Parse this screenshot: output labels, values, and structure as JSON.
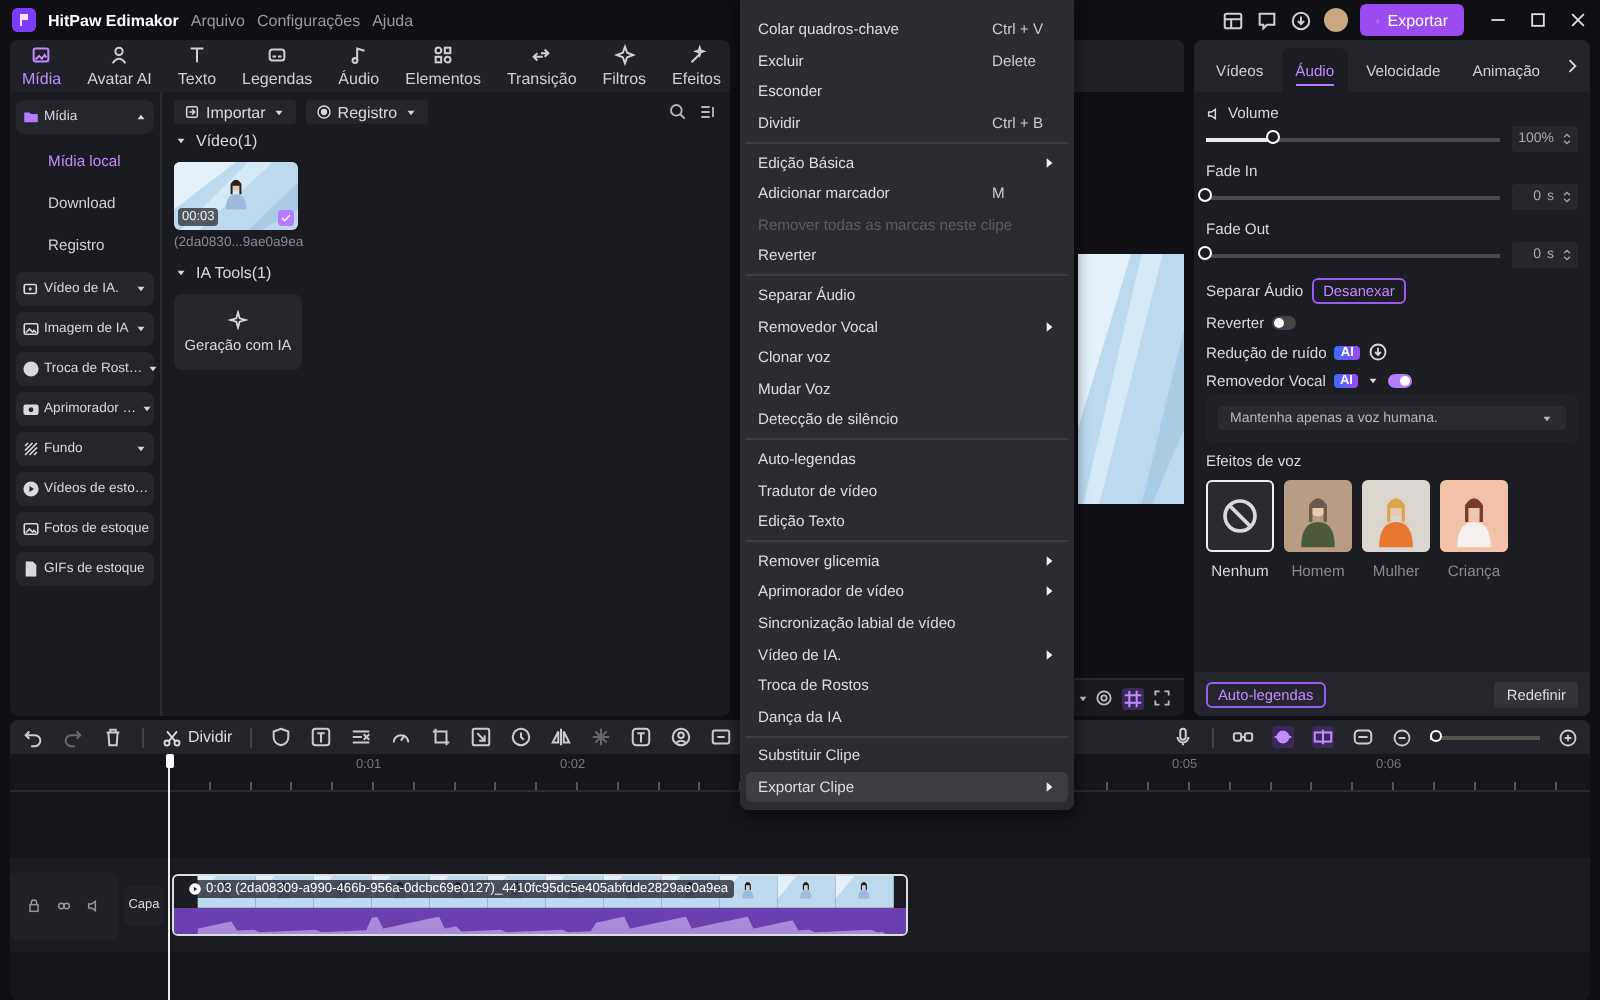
{
  "window": {
    "app_name": "HitPaw Edimakor",
    "menus": [
      "Arquivo",
      "Configurações",
      "Ajuda"
    ],
    "export_button": "Exportar"
  },
  "main_tabs": [
    {
      "label": "Mídia",
      "selected": true
    },
    {
      "label": "Avatar AI",
      "selected": false
    },
    {
      "label": "Texto",
      "selected": false
    },
    {
      "label": "Legendas",
      "selected": false
    },
    {
      "label": "Áudio",
      "selected": false
    },
    {
      "label": "Elementos",
      "selected": false
    },
    {
      "label": "Transição",
      "selected": false
    },
    {
      "label": "Filtros",
      "selected": false
    },
    {
      "label": "Efeitos",
      "selected": false
    }
  ],
  "sidebar": {
    "items": [
      {
        "label": "Mídia",
        "expanded": true,
        "selected": false,
        "children": [
          {
            "label": "Mídia local",
            "selected": true
          },
          {
            "label": "Download",
            "selected": false
          },
          {
            "label": "Registro",
            "selected": false
          }
        ]
      },
      {
        "label": "Vídeo de IA.",
        "expanded": false,
        "selected": false
      },
      {
        "label": "Imagem de IA",
        "expanded": false,
        "selected": false
      },
      {
        "label": "Troca de Rost…",
        "expanded": false,
        "selected": false
      },
      {
        "label": "Aprimorador …",
        "expanded": false,
        "selected": false
      },
      {
        "label": "Fundo",
        "expanded": false,
        "selected": false
      },
      {
        "label": "Vídeos de esto…",
        "selected": false
      },
      {
        "label": "Fotos de estoque",
        "selected": false
      },
      {
        "label": "GIFs de estoque",
        "selected": false
      }
    ]
  },
  "media": {
    "buttons": [
      "Importar",
      "Registro"
    ],
    "sections": [
      {
        "title": "Vídeo(1)",
        "expanded": true,
        "cards": [
          {
            "kind": "video",
            "duration": "00:03",
            "caption": "(2da0830...9ae0a9ea",
            "checked": true
          }
        ]
      },
      {
        "title": "IA Tools(1)",
        "expanded": true,
        "cards": [
          {
            "kind": "tool",
            "label": "Geração com IA"
          }
        ]
      }
    ]
  },
  "context_menu": {
    "groups": [
      [
        {
          "label": "Colar quadros-chave",
          "shortcut": "Ctrl + V",
          "submenu": false,
          "disabled": false,
          "selected": false
        },
        {
          "label": "Excluir",
          "shortcut": "Delete",
          "submenu": false,
          "disabled": false,
          "selected": false
        },
        {
          "label": "Esconder",
          "submenu": false,
          "disabled": false,
          "selected": false
        },
        {
          "label": "Dividir",
          "shortcut": "Ctrl + B",
          "submenu": false,
          "disabled": false,
          "selected": false
        }
      ],
      [
        {
          "label": "Edição Básica",
          "submenu": true,
          "disabled": false,
          "selected": false
        },
        {
          "label": "Adicionar marcador",
          "shortcut": "M",
          "submenu": false,
          "disabled": false,
          "selected": false
        },
        {
          "label": "Remover todas as marcas neste clipe",
          "submenu": false,
          "disabled": true,
          "selected": false
        },
        {
          "label": "Reverter",
          "submenu": false,
          "disabled": false,
          "selected": false
        }
      ],
      [
        {
          "label": "Separar Áudio",
          "submenu": false,
          "disabled": false,
          "selected": false
        },
        {
          "label": "Removedor Vocal",
          "submenu": true,
          "disabled": false,
          "selected": false
        },
        {
          "label": "Clonar voz",
          "submenu": false,
          "disabled": false,
          "selected": false
        },
        {
          "label": "Mudar Voz",
          "submenu": false,
          "disabled": false,
          "selected": false
        },
        {
          "label": "Detecção de silêncio",
          "submenu": false,
          "disabled": false,
          "selected": false
        }
      ],
      [
        {
          "label": "Auto-legendas",
          "submenu": false,
          "disabled": false,
          "selected": false
        },
        {
          "label": "Tradutor de vídeo",
          "submenu": false,
          "disabled": false,
          "selected": false
        },
        {
          "label": "Edição Texto",
          "submenu": false,
          "disabled": false,
          "selected": false
        }
      ],
      [
        {
          "label": "Remover glicemia",
          "submenu": true,
          "disabled": false,
          "selected": false
        },
        {
          "label": "Aprimorador de vídeo",
          "submenu": true,
          "disabled": false,
          "selected": false
        },
        {
          "label": "Sincronização labial de vídeo",
          "submenu": false,
          "disabled": false,
          "selected": false
        },
        {
          "label": "Vídeo de IA.",
          "submenu": true,
          "disabled": false,
          "selected": false
        },
        {
          "label": "Troca de Rostos",
          "submenu": false,
          "disabled": false,
          "selected": false
        },
        {
          "label": "Dança da IA",
          "submenu": false,
          "disabled": false,
          "selected": false
        }
      ],
      [
        {
          "label": "Substituir Clipe",
          "submenu": false,
          "disabled": false,
          "selected": false
        },
        {
          "label": "Exportar Clipe",
          "submenu": true,
          "disabled": false,
          "selected": true
        }
      ]
    ]
  },
  "properties": {
    "tabs": [
      {
        "label": "Vídeos",
        "selected": false
      },
      {
        "label": "Áudio",
        "selected": true
      },
      {
        "label": "Velocidade",
        "selected": false
      },
      {
        "label": "Animação",
        "selected": false
      }
    ],
    "sliders": [
      {
        "label": "Volume",
        "level": 0.23,
        "value": "100%"
      },
      {
        "label": "Fade In",
        "level": 0,
        "value": "0",
        "unit": "s"
      },
      {
        "label": "Fade Out",
        "level": 0,
        "value": "0",
        "unit": "s"
      }
    ],
    "separate_audio": {
      "label": "Separar Áudio",
      "button": "Desanexar"
    },
    "reverse": {
      "label": "Reverter",
      "on": false
    },
    "noise_reduction": {
      "label": "Redução de ruído",
      "badge": "AI"
    },
    "vocal_remover": {
      "label": "Removedor Vocal",
      "badge": "AI",
      "on": true,
      "option": "Mantenha apenas a voz humana."
    },
    "voice_effects": {
      "title": "Efeitos de voz",
      "items": [
        {
          "kind": "none",
          "label": "Nenhum",
          "selected": true
        },
        {
          "kind": "man",
          "label": "Homem",
          "selected": false
        },
        {
          "kind": "woman",
          "label": "Mulher",
          "selected": false
        },
        {
          "kind": "child",
          "label": "Criança",
          "selected": false
        }
      ]
    },
    "footer": [
      "Auto-legendas",
      "Redefinir"
    ]
  },
  "timeline": {
    "split_label": "Dividir",
    "ruler_labels": [
      "0:01",
      "0:02",
      "0:05",
      "0:06"
    ],
    "zoom": {
      "level": 0.05
    },
    "cover_button": "Capa",
    "clip": {
      "title": "0:03 (2da08309-a990-466b-956a-0dcbc69e0127)_4410fc95dc5e405abfdde2829ae0a9ea"
    }
  }
}
